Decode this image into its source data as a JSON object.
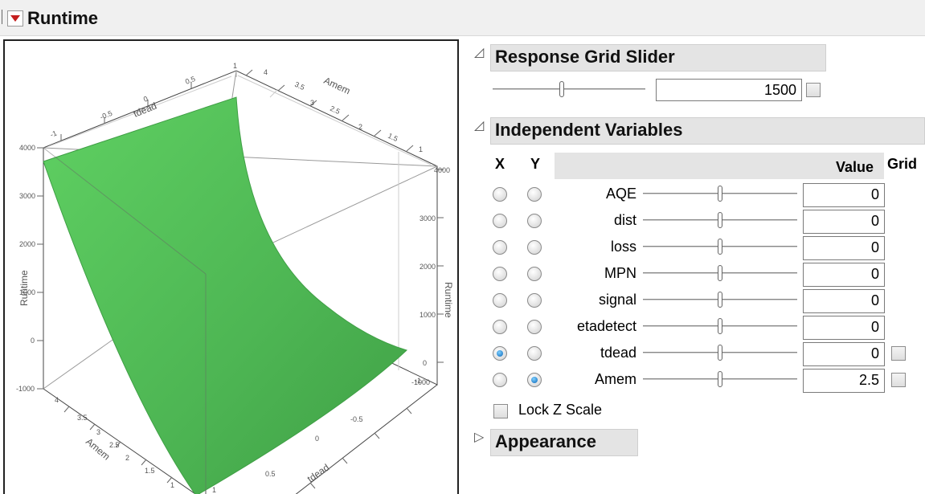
{
  "window": {
    "title": "Runtime"
  },
  "plot": {
    "axis_labels": {
      "z_left": "Runtime",
      "z_right": "Runtime",
      "top_x": "tdead",
      "top_y": "Amem",
      "bottom_x": "tdead",
      "bottom_y": "Amem"
    },
    "ticks": {
      "top_tdead": [
        "-1",
        "-0.5",
        "0",
        "0.5",
        "1"
      ],
      "top_amem": [
        "4",
        "3.5",
        "3",
        "2.5",
        "2",
        "1.5",
        "1"
      ],
      "left_runtime": [
        "4000",
        "3000",
        "2000",
        "1000",
        "0",
        "-1000"
      ],
      "right_runtime": [
        "4000",
        "3000",
        "2000",
        "1000",
        "0",
        "-1000"
      ],
      "bottom_amem": [
        "4",
        "3.5",
        "3",
        "2.5",
        "2",
        "1.5",
        "1"
      ],
      "bottom_tdead": [
        "1",
        "0.5",
        "0",
        "-0.5",
        "-1"
      ]
    },
    "surface_color": "#55c45a"
  },
  "grid_slider": {
    "title": "Response Grid Slider",
    "value": "1500",
    "position": 0.45
  },
  "independent": {
    "title": "Independent Variables",
    "col_x": "X",
    "col_y": "Y",
    "col_value": "Value",
    "col_grid": "Grid",
    "rows": [
      {
        "name": "AQE",
        "value": "0",
        "x": false,
        "y": false,
        "grid": false,
        "position": 0.5
      },
      {
        "name": "dist",
        "value": "0",
        "x": false,
        "y": false,
        "grid": false,
        "position": 0.5
      },
      {
        "name": "loss",
        "value": "0",
        "x": false,
        "y": false,
        "grid": false,
        "position": 0.5
      },
      {
        "name": "MPN",
        "value": "0",
        "x": false,
        "y": false,
        "grid": false,
        "position": 0.5
      },
      {
        "name": "signal",
        "value": "0",
        "x": false,
        "y": false,
        "grid": false,
        "position": 0.5
      },
      {
        "name": "etadetect",
        "value": "0",
        "x": false,
        "y": false,
        "grid": false,
        "position": 0.5
      },
      {
        "name": "tdead",
        "value": "0",
        "x": true,
        "y": false,
        "grid": true,
        "position": 0.5
      },
      {
        "name": "Amem",
        "value": "2.5",
        "x": false,
        "y": true,
        "grid": true,
        "position": 0.5
      }
    ]
  },
  "lock_z": {
    "label": "Lock Z Scale",
    "checked": false
  },
  "appearance": {
    "title": "Appearance"
  }
}
